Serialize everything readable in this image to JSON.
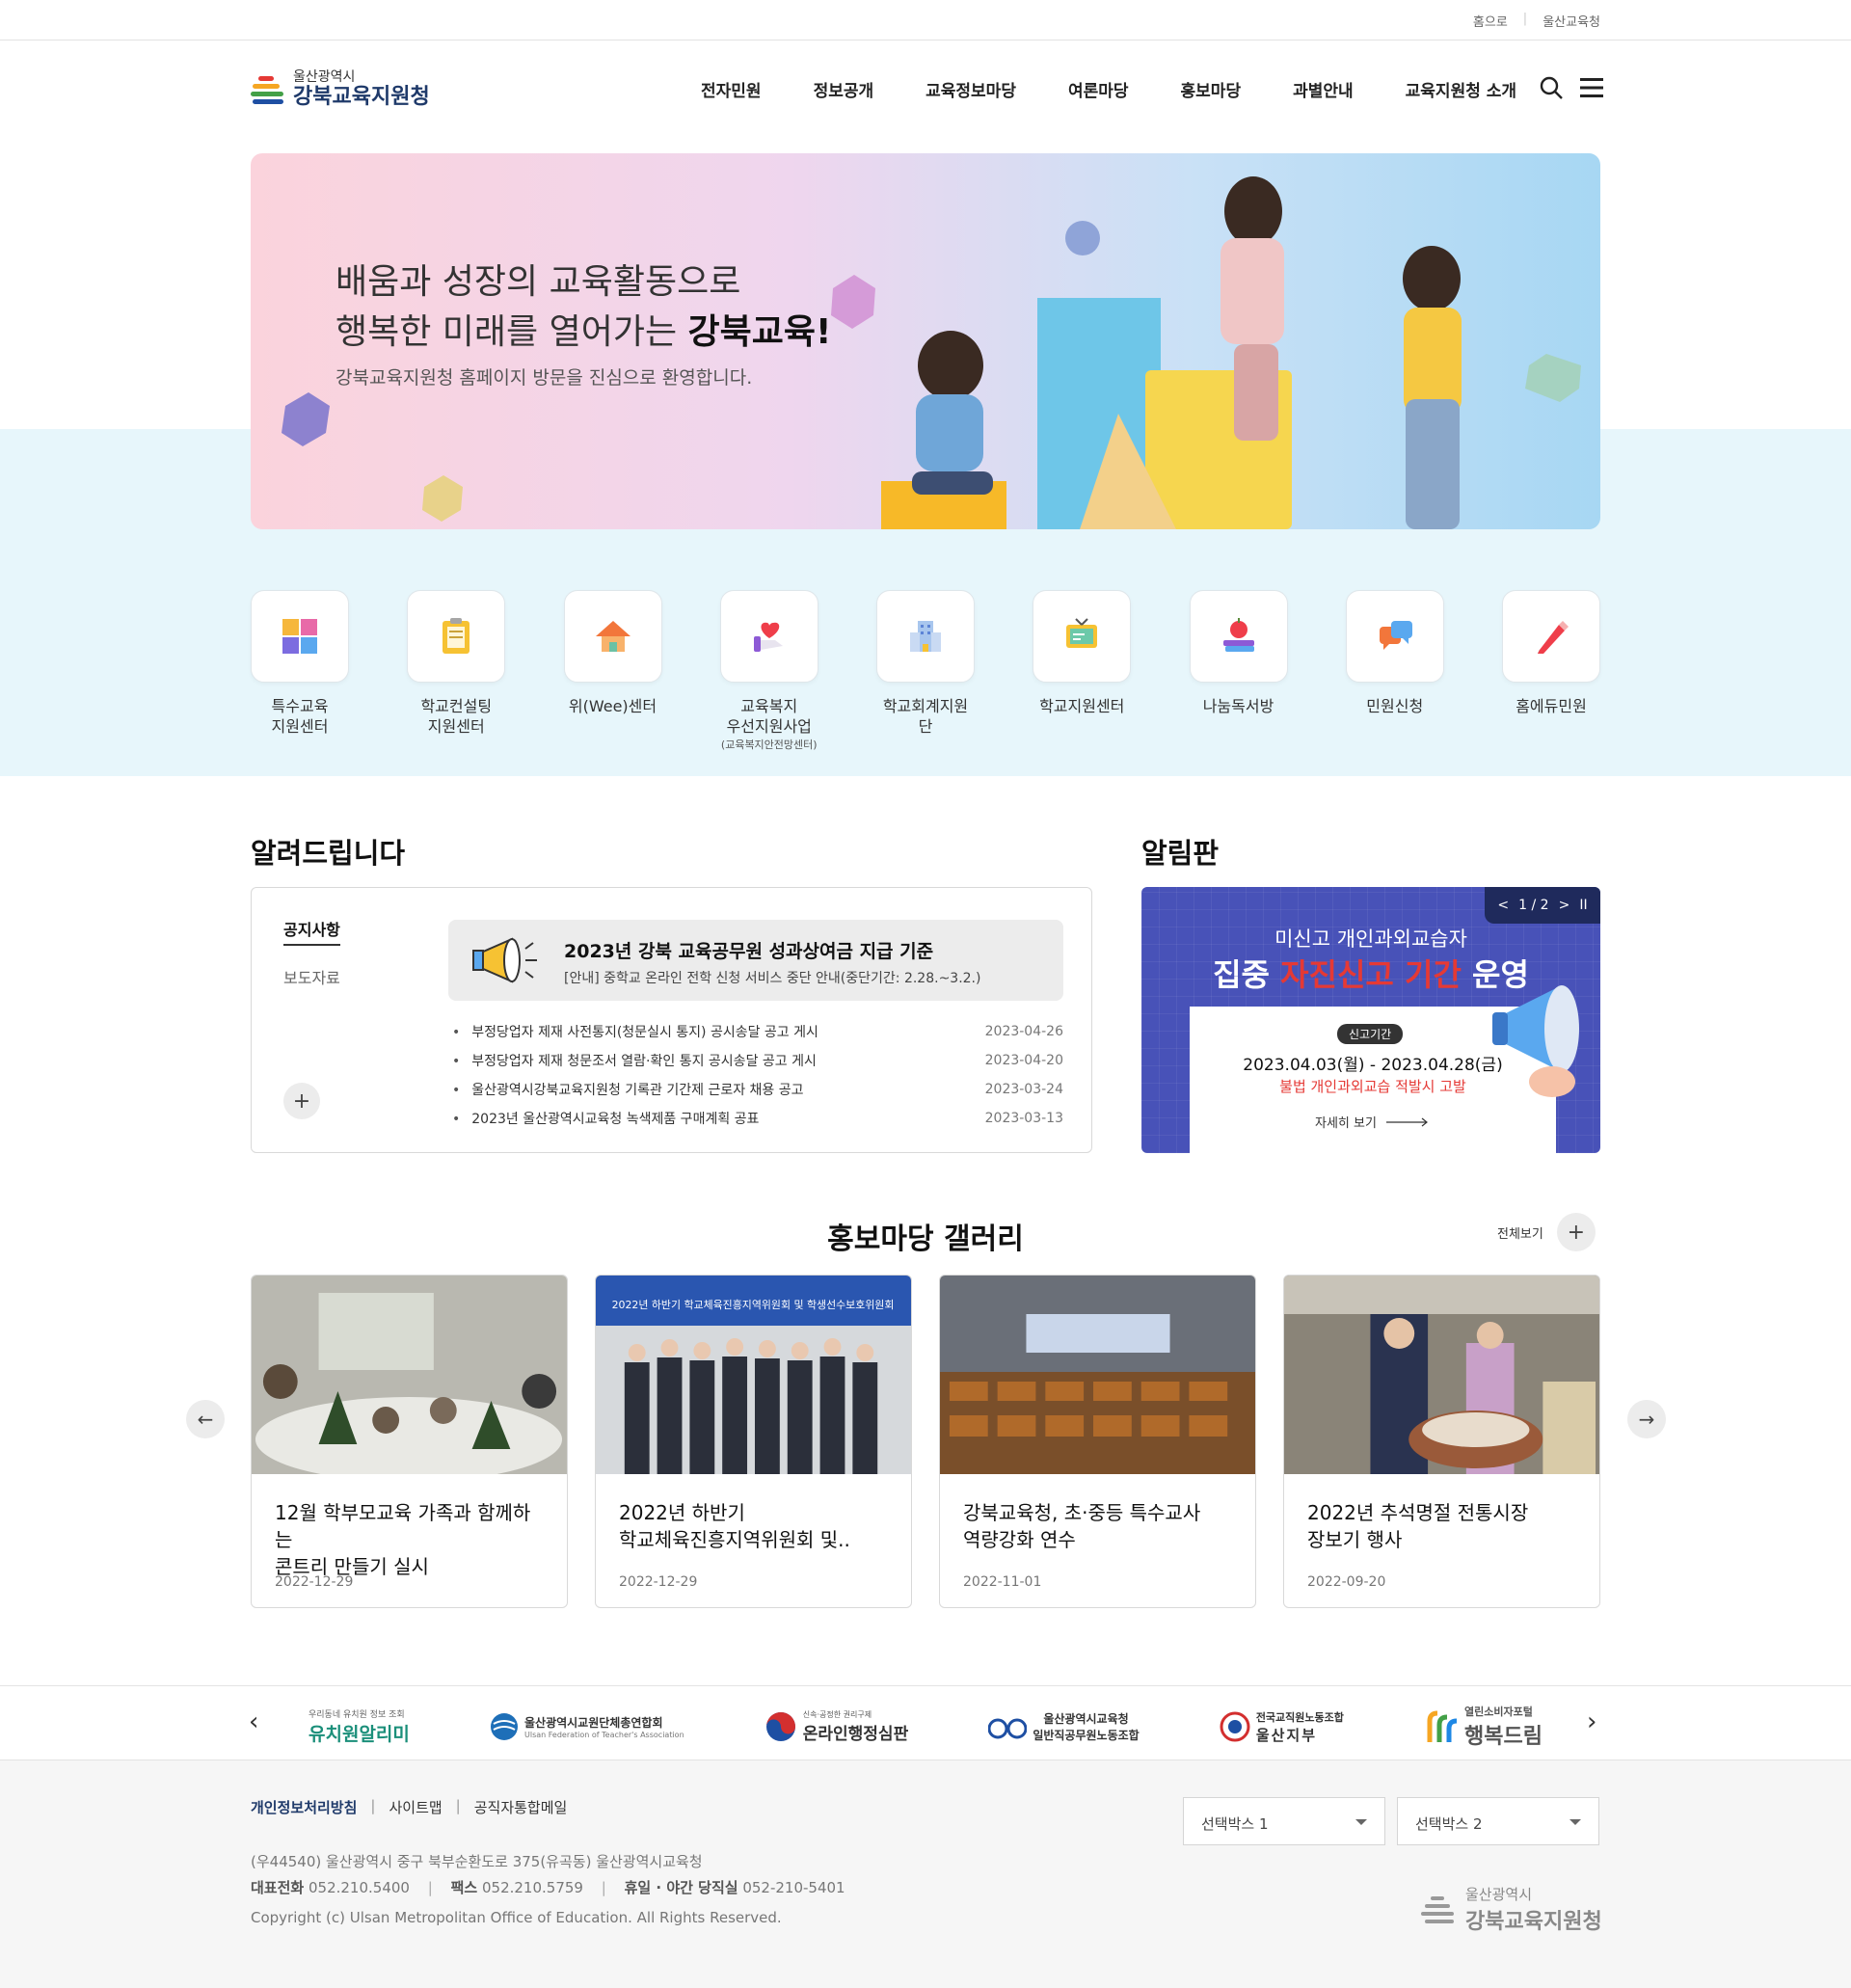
{
  "colors": {
    "brand_navy": "#1f3a6a",
    "sky_bg": "#e7f6fb",
    "alim_bg": "#4852b8",
    "accent_red": "#e53935"
  },
  "top_links": {
    "home": "홈으로",
    "ulsan": "울산교육청"
  },
  "header": {
    "logo_small": "울산광역시",
    "logo_big": "강북교육지원청",
    "nav": [
      "전자민원",
      "정보공개",
      "교육정보마당",
      "여론마당",
      "홍보마당",
      "과별안내",
      "교육지원청 소개"
    ],
    "icons": [
      "search-icon",
      "menu-icon"
    ]
  },
  "banner": {
    "line1": "배움과 성장의 교육활동으로",
    "line2_pre": "행복한 미래를 열어가는 ",
    "line2_bold": "강북교육!",
    "sub": "강북교육지원청 홈페이지 방문을 진심으로 환영합니다."
  },
  "quick": [
    {
      "label": "특수교육\n지원센터",
      "sub": "",
      "icon": "puzzle-icon"
    },
    {
      "label": "학교컨설팅\n지원센터",
      "sub": "",
      "icon": "clipboard-icon"
    },
    {
      "label": "위(Wee)센터",
      "sub": "",
      "icon": "house-icon"
    },
    {
      "label": "교육복지\n우선지원사업",
      "sub": "(교육복지안전망센터)",
      "icon": "heart-hand-icon"
    },
    {
      "label": "학교회계지원단",
      "sub": "",
      "icon": "building-icon"
    },
    {
      "label": "학교지원센터",
      "sub": "",
      "icon": "board-icon"
    },
    {
      "label": "나눔독서방",
      "sub": "",
      "icon": "book-apple-icon"
    },
    {
      "label": "민원신청",
      "sub": "",
      "icon": "chat-icon"
    },
    {
      "label": "홈에듀민원",
      "sub": "",
      "icon": "pencil-icon"
    }
  ],
  "notice": {
    "title": "알려드립니다",
    "tabs": [
      "공지사항",
      "보도자료"
    ],
    "more": "+",
    "highlight": {
      "title": "2023년 강북 교육공무원 성과상여금 지급 기준",
      "sub": "[안내] 중학교 온라인 전학 신청 서비스 중단 안내(중단기간: 2.28.~3.2.)"
    },
    "items": [
      {
        "title": "부정당업자 제재 사전통지(청문실시 통지) 공시송달 공고 게시",
        "date": "2023-04-26"
      },
      {
        "title": "부정당업자 제재 청문조서 열람·확인 통지 공시송달 공고 게시",
        "date": "2023-04-20"
      },
      {
        "title": "울산광역시강북교육지원청 기록관 기간제 근로자 채용 공고",
        "date": "2023-03-24"
      },
      {
        "title": "2023년 울산광역시교육청 녹색제품 구매계획 공표",
        "date": "2023-03-13"
      }
    ]
  },
  "alim": {
    "title": "알림판",
    "pager": "1 / 2",
    "line1": "미신고 개인과외교습자",
    "line2_a": "집중 ",
    "line2_b": "자진신고 기간",
    "line2_c": " 운영",
    "badge": "신고기간",
    "period": "2023.04.03(월) - 2023.04.28(금)",
    "warn": "불법 개인과외교습 적발시 고발",
    "more": "자세히 보기"
  },
  "gallery": {
    "title": "홍보마당 갤러리",
    "view_all": "전체보기",
    "cards": [
      {
        "title": "12월 학부모교육 가족과 함께하는\n콘트리 만들기 실시",
        "date": "2022-12-29"
      },
      {
        "title": "2022년 하반기\n학교체육진흥지역위원회 및..",
        "date": "2022-12-29"
      },
      {
        "title": "강북교육청, 초·중등 특수교사\n역량강화 연수",
        "date": "2022-11-01"
      },
      {
        "title": "2022년 추석명절 전통시장\n장보기 행사",
        "date": "2022-09-20"
      }
    ],
    "card2_banner": "2022년 하반기 학교체육진흥지역위원회 및 학생선수보호위원회"
  },
  "partners": [
    {
      "small": "우리동네 유치원 정보 조회",
      "big": "유치원알리미"
    },
    {
      "small": "Ulsan Federation of Teacher's Association",
      "big": "울산광역시교원단체총연합회"
    },
    {
      "small": "신속·공정한 권리구제",
      "big": "온라인행정심판"
    },
    {
      "small": "울산광역시교육청",
      "big": "일반직공무원노동조합"
    },
    {
      "small": "전국교직원노동조합",
      "big": "울산지부"
    },
    {
      "small": "열린소비자포털",
      "big": "행복드림"
    }
  ],
  "footer": {
    "links": [
      "개인정보처리방침",
      "사이트맵",
      "공직자통합메일"
    ],
    "address": "(우44540) 울산광역시 중구 북부순환도로 375(유곡동) 울산광역시교육청",
    "tel_label": "대표전화",
    "tel": "052.210.5400",
    "fax_label": "팩스",
    "fax": "052.210.5759",
    "night_label": "휴일 · 야간 당직실",
    "night": "052-210-5401",
    "copyright": "Copyright (c) Ulsan Metropolitan Office of Education. All Rights Reserved.",
    "select1": "선택박스 1",
    "select2": "선택박스 2",
    "logo_small": "울산광역시",
    "logo_big": "강북교육지원청"
  }
}
